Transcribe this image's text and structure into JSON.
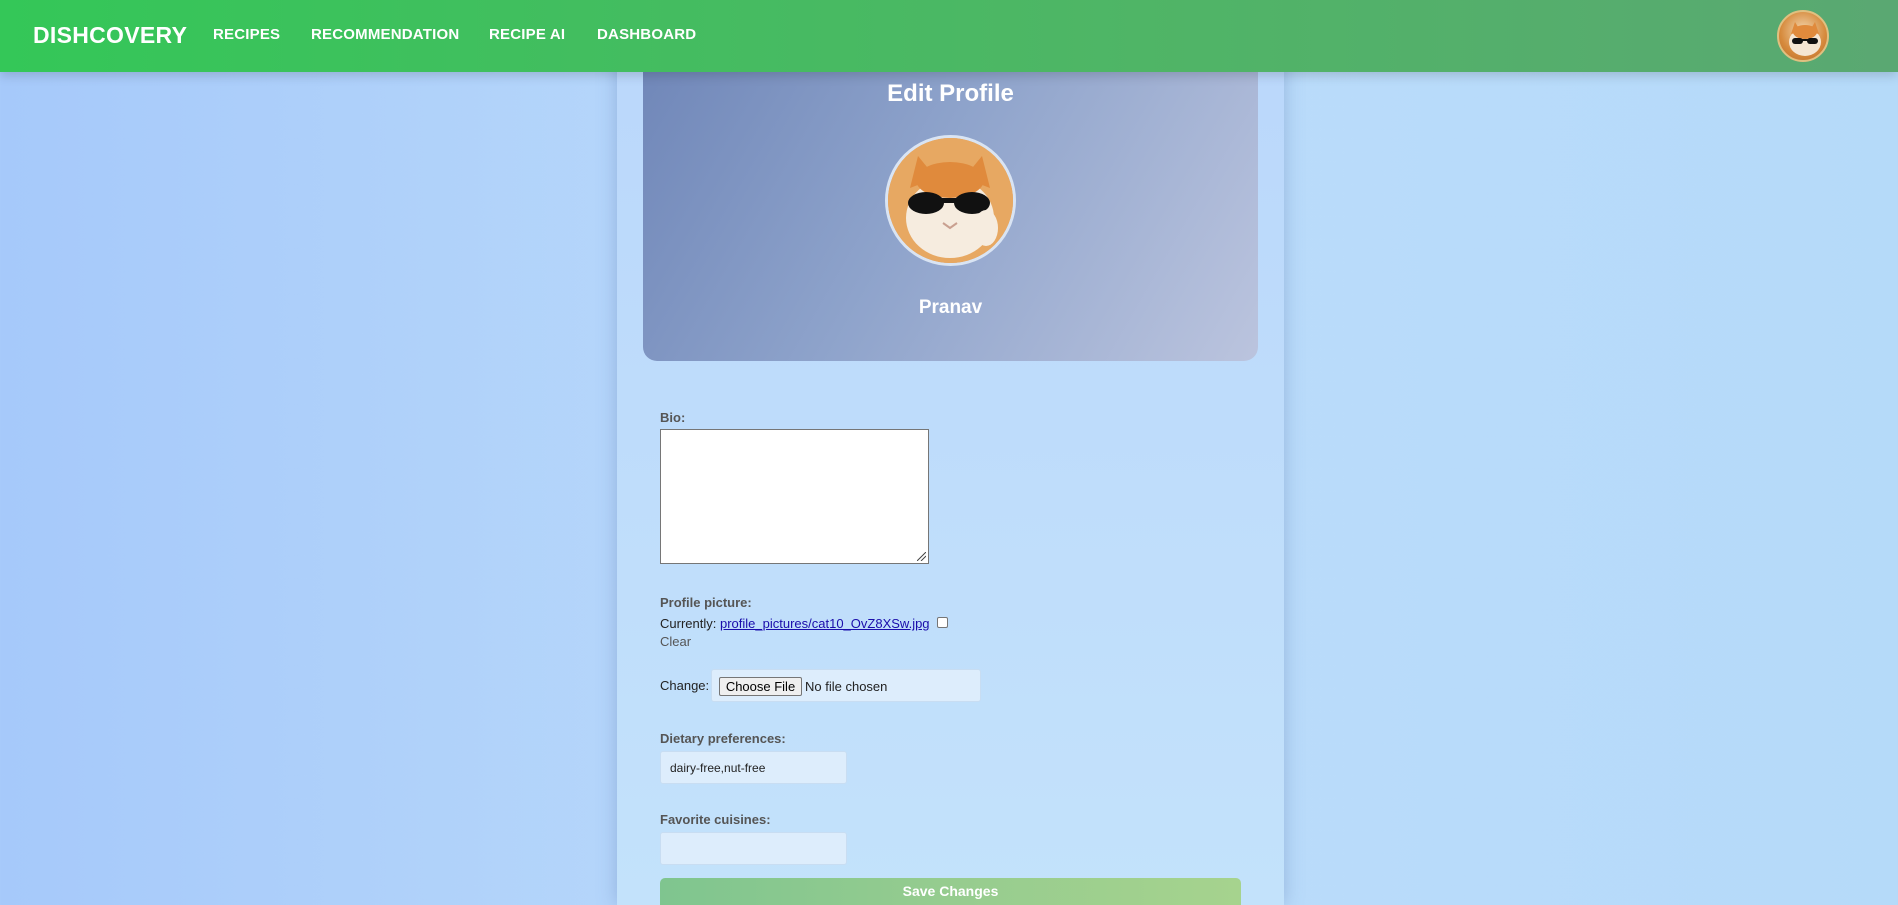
{
  "nav": {
    "brand": "DISHCOVERY",
    "links": [
      "RECIPES",
      "RECOMMENDATION",
      "RECIPE AI",
      "DASHBOARD"
    ]
  },
  "profile": {
    "title": "Edit Profile",
    "username": "Pranav"
  },
  "form": {
    "bio_label": "Bio:",
    "bio_value": "",
    "picture_label": "Profile picture:",
    "currently_label": "Currently:",
    "current_file": "profile_pictures/cat10_OvZ8XSw.jpg",
    "clear_label": "Clear",
    "change_label": "Change:",
    "choose_file_label": "Choose File",
    "no_file_text": "No file chosen",
    "dietary_label": "Dietary preferences:",
    "dietary_value": "dairy-free,nut-free",
    "cuisines_label": "Favorite cuisines:",
    "cuisines_value": "",
    "save_label": "Save Changes"
  },
  "colors": {
    "navbar": "#34c758",
    "save_button": "#96cc8f",
    "header_gradient_start": "#6f86b8"
  }
}
